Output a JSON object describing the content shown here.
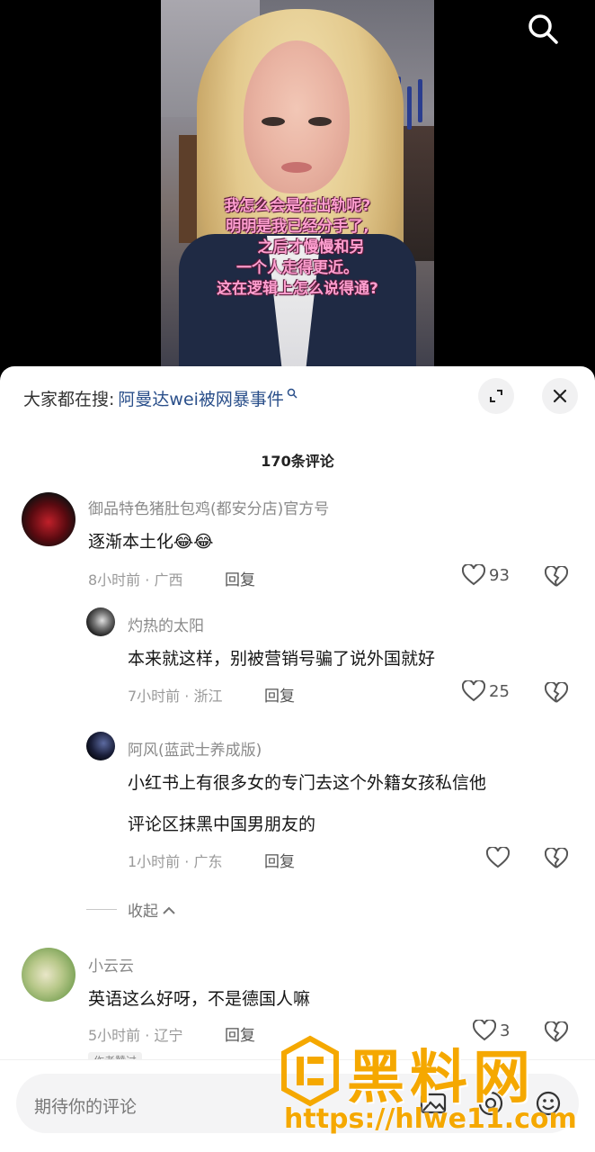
{
  "video": {
    "subtitle_lines": [
      "我怎么会是在出轨呢?",
      "明明是我已经分手了,",
      "之后才慢慢和另",
      "一个人走得更近。",
      "这在逻辑上怎么说得通?"
    ]
  },
  "sheet": {
    "hot_search_prefix": "大家都在搜:",
    "hot_search_term": "阿曼达wei被网暴事件",
    "comment_count": "170条评论"
  },
  "comments": [
    {
      "name": "御品特色猪肚包鸡(都安分店)官方号",
      "text": "逐渐本土化",
      "emoji": "😂😂",
      "meta": "8小时前 · 广西",
      "reply": "回复",
      "likes": "93"
    },
    {
      "name": "灼热的太阳",
      "text": "本来就这样，别被营销号骗了说外国就好",
      "meta": "7小时前 · 浙江",
      "reply": "回复",
      "likes": "25"
    },
    {
      "name": "阿风(蓝武士养成版)",
      "text_line1": "小红书上有很多女的专门去这个外籍女孩私信他",
      "text_line2": "评论区抹黑中国男朋友的",
      "meta": "1小时前 · 广东",
      "reply": "回复",
      "likes": ""
    },
    {
      "name": "小云云",
      "text": "英语这么好呀，不是德国人嘛",
      "meta": "5小时前 · 辽宁",
      "reply": "回复",
      "likes": "3",
      "tag": "作者赞过"
    }
  ],
  "collapse_label": "收起",
  "input": {
    "placeholder": "期待你的评论"
  },
  "watermark": {
    "title": "黑料网",
    "url": "https://hlwe11.com"
  },
  "colors": {
    "subtitle": "#ff9fd0",
    "link": "#2a4f8a",
    "watermark": "#f5a800"
  }
}
